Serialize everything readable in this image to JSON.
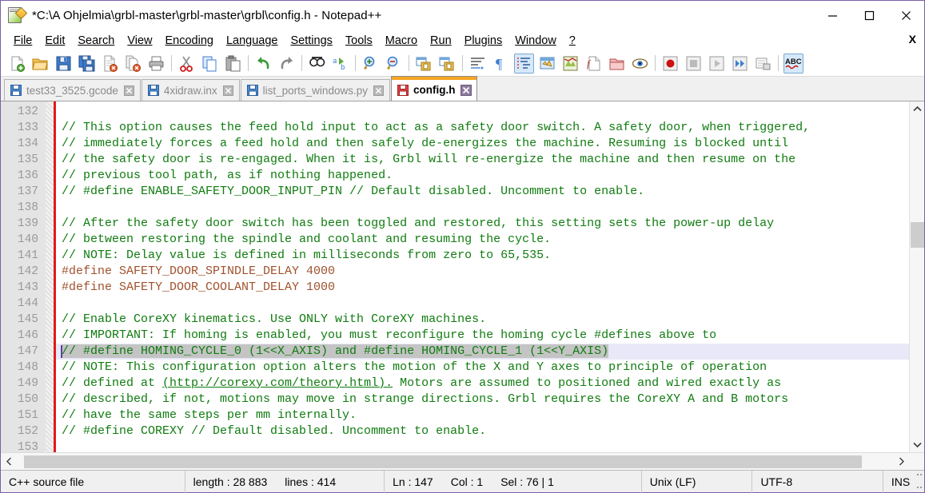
{
  "window": {
    "title": "*C:\\A Ohjelmia\\grbl-master\\grbl-master\\grbl\\config.h - Notepad++",
    "icon": "notepad-plus-plus-icon",
    "minimize_label": "minimize-icon",
    "maximize_label": "maximize-icon",
    "close_label": "close-icon"
  },
  "menubar": {
    "items": [
      {
        "label": "File",
        "mnemonic": "F"
      },
      {
        "label": "Edit",
        "mnemonic": "E"
      },
      {
        "label": "Search",
        "mnemonic": "S"
      },
      {
        "label": "View",
        "mnemonic": "V"
      },
      {
        "label": "Encoding",
        "mnemonic": "n"
      },
      {
        "label": "Language",
        "mnemonic": "L"
      },
      {
        "label": "Settings",
        "mnemonic": "t"
      },
      {
        "label": "Tools",
        "mnemonic": "o"
      },
      {
        "label": "Macro",
        "mnemonic": "M"
      },
      {
        "label": "Run",
        "mnemonic": "R"
      },
      {
        "label": "Plugins",
        "mnemonic": "P"
      },
      {
        "label": "Window",
        "mnemonic": "W"
      },
      {
        "label": "?",
        "mnemonic": "?"
      }
    ],
    "close_document": "X"
  },
  "toolbar": {
    "buttons": [
      {
        "name": "new-file-icon",
        "title": "New"
      },
      {
        "name": "open-file-icon",
        "title": "Open"
      },
      {
        "name": "save-icon",
        "title": "Save"
      },
      {
        "name": "save-all-icon",
        "title": "Save All"
      },
      {
        "name": "close-file-icon",
        "title": "Close"
      },
      {
        "name": "close-all-icon",
        "title": "Close All"
      },
      {
        "name": "print-icon",
        "title": "Print"
      },
      {
        "name": "separator",
        "title": ""
      },
      {
        "name": "cut-icon",
        "title": "Cut"
      },
      {
        "name": "copy-icon",
        "title": "Copy"
      },
      {
        "name": "paste-icon",
        "title": "Paste"
      },
      {
        "name": "separator",
        "title": ""
      },
      {
        "name": "undo-icon",
        "title": "Undo"
      },
      {
        "name": "redo-icon",
        "title": "Redo"
      },
      {
        "name": "separator",
        "title": ""
      },
      {
        "name": "find-icon",
        "title": "Find"
      },
      {
        "name": "replace-icon",
        "title": "Replace"
      },
      {
        "name": "separator",
        "title": ""
      },
      {
        "name": "zoom-in-icon",
        "title": "Zoom In"
      },
      {
        "name": "zoom-out-icon",
        "title": "Zoom Out"
      },
      {
        "name": "separator",
        "title": ""
      },
      {
        "name": "sync-vertical-scroll-icon",
        "title": "Synchronize Vertical Scrolling"
      },
      {
        "name": "sync-horizontal-scroll-icon",
        "title": "Synchronize Horizontal Scrolling"
      },
      {
        "name": "separator",
        "title": ""
      },
      {
        "name": "word-wrap-icon",
        "title": "Word Wrap"
      },
      {
        "name": "show-all-characters-icon",
        "title": "Show All Characters"
      },
      {
        "name": "indent-guide-icon",
        "title": "Show Indent Guide",
        "active": true
      },
      {
        "name": "user-defined-language-icon",
        "title": "User Defined Language"
      },
      {
        "name": "document-map-icon",
        "title": "Document Map"
      },
      {
        "name": "function-list-icon",
        "title": "Function List"
      },
      {
        "name": "folder-as-workspace-icon",
        "title": "Folder as Workspace"
      },
      {
        "name": "monitoring-icon",
        "title": "Monitoring"
      },
      {
        "name": "separator",
        "title": ""
      },
      {
        "name": "record-macro-icon",
        "title": "Start Recording"
      },
      {
        "name": "stop-macro-icon",
        "title": "Stop Recording"
      },
      {
        "name": "play-macro-icon",
        "title": "Playback"
      },
      {
        "name": "run-macro-multiple-icon",
        "title": "Run a Macro Multiple Times"
      },
      {
        "name": "save-macro-icon",
        "title": "Save Currently Recorded Macro"
      },
      {
        "name": "separator",
        "title": ""
      },
      {
        "name": "spell-check-icon",
        "title": "Spell Checker",
        "active": true,
        "text": "ABC"
      }
    ]
  },
  "tabs": [
    {
      "label": "test33_3525.gcode",
      "active": false,
      "modified": false
    },
    {
      "label": "4xidraw.inx",
      "active": false,
      "modified": false
    },
    {
      "label": "list_ports_windows.py",
      "active": false,
      "modified": false
    },
    {
      "label": "config.h",
      "active": true,
      "modified": true
    }
  ],
  "editor": {
    "first_line": 132,
    "current_line": 147,
    "lines": [
      {
        "n": 132,
        "text": "",
        "type": "blank"
      },
      {
        "n": 133,
        "text": "// This option causes the feed hold input to act as a safety door switch. A safety door, when triggered,",
        "type": "comment"
      },
      {
        "n": 134,
        "text": "// immediately forces a feed hold and then safely de-energizes the machine. Resuming is blocked until",
        "type": "comment"
      },
      {
        "n": 135,
        "text": "// the safety door is re-engaged. When it is, Grbl will re-energize the machine and then resume on the",
        "type": "comment"
      },
      {
        "n": 136,
        "text": "// previous tool path, as if nothing happened.",
        "type": "comment"
      },
      {
        "n": 137,
        "text": "// #define ENABLE_SAFETY_DOOR_INPUT_PIN // Default disabled. Uncomment to enable.",
        "type": "comment"
      },
      {
        "n": 138,
        "text": "",
        "type": "blank"
      },
      {
        "n": 139,
        "text": "// After the safety door switch has been toggled and restored, this setting sets the power-up delay",
        "type": "comment"
      },
      {
        "n": 140,
        "text": "// between restoring the spindle and coolant and resuming the cycle.",
        "type": "comment"
      },
      {
        "n": 141,
        "text": "// NOTE: Delay value is defined in milliseconds from zero to 65,535.",
        "type": "comment"
      },
      {
        "n": 142,
        "text": "#define SAFETY_DOOR_SPINDLE_DELAY 4000",
        "type": "define"
      },
      {
        "n": 143,
        "text": "#define SAFETY_DOOR_COOLANT_DELAY 1000",
        "type": "define"
      },
      {
        "n": 144,
        "text": "",
        "type": "blank"
      },
      {
        "n": 145,
        "text": "// Enable CoreXY kinematics. Use ONLY with CoreXY machines.",
        "type": "comment"
      },
      {
        "n": 146,
        "text": "// IMPORTANT: If homing is enabled, you must reconfigure the homing cycle #defines above to",
        "type": "comment"
      },
      {
        "n": 147,
        "text": "// #define HOMING_CYCLE_0 (1<<X_AXIS) and #define HOMING_CYCLE_1 (1<<Y_AXIS)",
        "type": "comment",
        "current": true,
        "selected": true
      },
      {
        "n": 148,
        "text": "// NOTE: This configuration option alters the motion of the X and Y axes to principle of operation",
        "type": "comment"
      },
      {
        "n": 149,
        "text": "// defined at (http://corexy.com/theory.html). Motors are assumed to positioned and wired exactly as",
        "type": "comment",
        "link": "(http://corexy.com/theory.html)."
      },
      {
        "n": 150,
        "text": "// described, if not, motions may move in strange directions. Grbl requires the CoreXY A and B motors",
        "type": "comment"
      },
      {
        "n": 151,
        "text": "// have the same steps per mm internally.",
        "type": "comment"
      },
      {
        "n": 152,
        "text": "// #define COREXY // Default disabled. Uncomment to enable.",
        "type": "comment"
      },
      {
        "n": 153,
        "text": "",
        "type": "blank"
      }
    ],
    "line149_parts": {
      "before": "// defined at ",
      "link": "(http://corexy.com/theory.html).",
      "after": " Motors are assumed to positioned and wired exactly as"
    },
    "line147_parts": {
      "selected": "// #define HOMING_CYCLE_0 (1<<X_AXIS) and #define HOMING_CYCLE_1 (1<<Y_AXIS)"
    }
  },
  "statusbar": {
    "file_type": "C++ source file",
    "length_label": "length : 28 883",
    "lines_label": "lines : 414",
    "ln_label": "Ln : 147",
    "col_label": "Col : 1",
    "sel_label": "Sel : 76 | 1",
    "eol": "Unix (LF)",
    "encoding": "UTF-8",
    "insert_mode": "INS"
  },
  "colors": {
    "comment_green": "#107c10",
    "define_orange": "#a0522d",
    "tab_active_top": "#f5a623",
    "change_bar_red": "#e01b1b",
    "current_line": "#e8e8f8",
    "selection": "#c4c4c4",
    "window_border": "#7b5fa8",
    "gutter_bg": "#e4e4e4",
    "line_number": "#9a9a9a"
  }
}
